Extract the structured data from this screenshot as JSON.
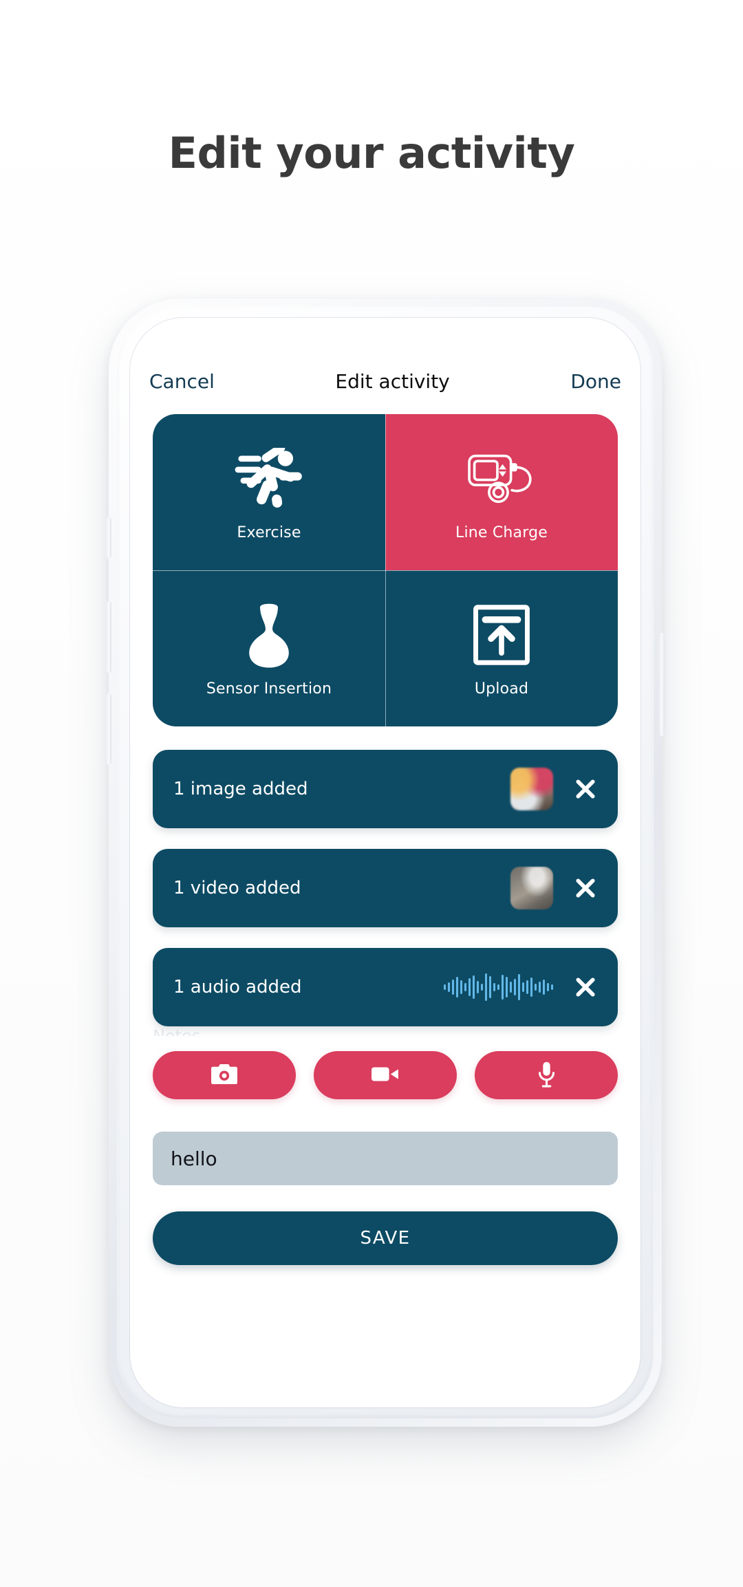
{
  "page": {
    "title": "Edit your activity"
  },
  "colors": {
    "primary_dark_teal": "#0D4B64",
    "accent_pink": "#DA3D5D",
    "input_grey": "#BFCBD3",
    "nav_link": "#123A52",
    "title_grey": "#3A3A3A",
    "white": "#FFFFFF",
    "waveform_blue": "#63B8E8"
  },
  "navbar": {
    "cancel_label": "Cancel",
    "title": "Edit activity",
    "done_label": "Done"
  },
  "activity_grid": {
    "tiles": [
      {
        "label": "Exercise",
        "icon": "running-person-icon",
        "selected": false
      },
      {
        "label": "Line Charge",
        "icon": "insulin-pump-icon",
        "selected": true
      },
      {
        "label": "Sensor Insertion",
        "icon": "sensor-icon",
        "selected": false
      },
      {
        "label": "Upload",
        "icon": "upload-box-arrow-icon",
        "selected": false
      }
    ]
  },
  "attachments": [
    {
      "label": "1 image added",
      "type": "image",
      "remove_icon": "close-icon"
    },
    {
      "label": "1 video added",
      "type": "video",
      "remove_icon": "close-icon"
    },
    {
      "label": "1 audio added",
      "type": "audio",
      "remove_icon": "close-icon"
    }
  ],
  "capture_buttons": [
    {
      "icon": "camera-icon",
      "name": "add-photo-button"
    },
    {
      "icon": "video-cam-icon",
      "name": "add-video-button"
    },
    {
      "icon": "microphone-icon",
      "name": "add-audio-button"
    }
  ],
  "note": {
    "value": "hello",
    "placeholder": "Notes"
  },
  "save": {
    "label": "SAVE"
  }
}
